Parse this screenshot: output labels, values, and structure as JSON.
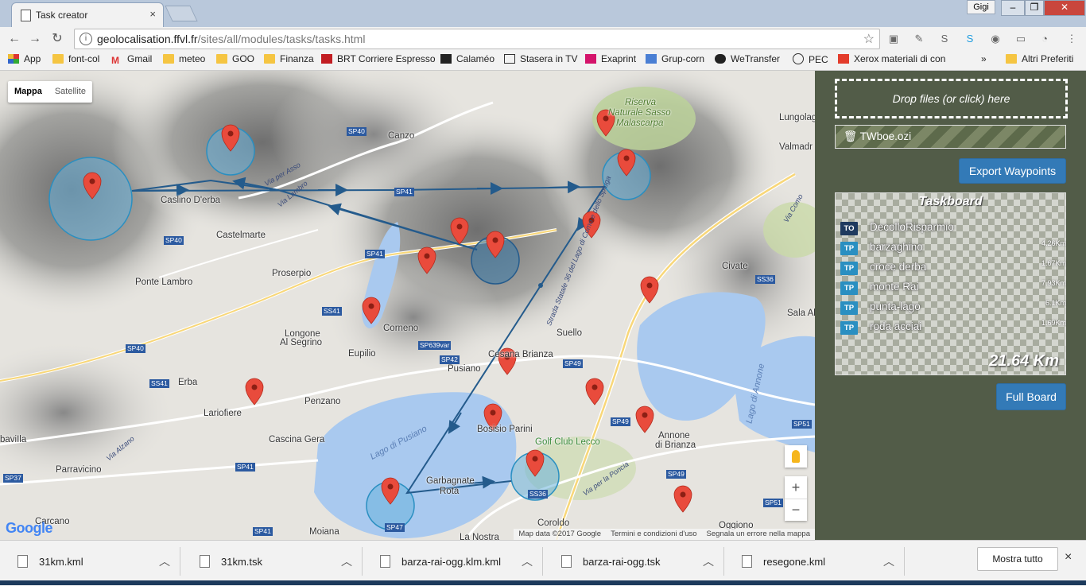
{
  "browser": {
    "tab_title": "Task creator",
    "tab_close": "×",
    "profile": "Gigi",
    "url_host": "geolocalisation.ffvl.fr",
    "url_path": "/sites/all/modules/tasks/tasks.html"
  },
  "bookmarks": [
    {
      "label": "App",
      "icon": "apps-grid-icon"
    },
    {
      "label": "font-col",
      "icon": "folder-icon"
    },
    {
      "label": "Gmail",
      "icon": "gmail-icon"
    },
    {
      "label": "meteo",
      "icon": "folder-icon"
    },
    {
      "label": "GOO",
      "icon": "folder-icon"
    },
    {
      "label": "Finanza",
      "icon": "folder-icon"
    },
    {
      "label": "BRT Corriere Espresso",
      "icon": "brt-icon"
    },
    {
      "label": "Calaméo",
      "icon": "calameo-icon"
    },
    {
      "label": "Stasera in TV",
      "icon": "tv-icon"
    },
    {
      "label": "Exaprint",
      "icon": "exaprint-icon"
    },
    {
      "label": "Grup-corn",
      "icon": "group-icon"
    },
    {
      "label": "WeTransfer",
      "icon": "wetransfer-icon"
    },
    {
      "label": "PEC",
      "icon": "pec-icon"
    },
    {
      "label": "Xerox materiali di con",
      "icon": "xerox-icon"
    },
    {
      "label": "»",
      "icon": ""
    },
    {
      "label": "Altri Preferiti",
      "icon": "folder-icon"
    }
  ],
  "map": {
    "type_control": {
      "map_label": "Mappa",
      "satellite_label": "Satellite"
    },
    "places": [
      {
        "name": "Canzo"
      },
      {
        "name": "Caslino D'erba"
      },
      {
        "name": "Castelmarte"
      },
      {
        "name": "Ponte Lambro"
      },
      {
        "name": "Proserpio"
      },
      {
        "name": "Longone"
      },
      {
        "name": "Al Segrino"
      },
      {
        "name": "Eupilio"
      },
      {
        "name": "Corneno"
      },
      {
        "name": "Cesana Brianza"
      },
      {
        "name": "Suello"
      },
      {
        "name": "Pusiano"
      },
      {
        "name": "Erba"
      },
      {
        "name": "Lariofiere"
      },
      {
        "name": "Penzano"
      },
      {
        "name": "Cascina Gera"
      },
      {
        "name": "Parravicino"
      },
      {
        "name": "Bosisio Parini"
      },
      {
        "name": "Garbagnate"
      },
      {
        "name": "Rota"
      },
      {
        "name": "Annone"
      },
      {
        "name": "di Brianza"
      },
      {
        "name": "Civate"
      },
      {
        "name": "Lungolago"
      },
      {
        "name": "Valmadr"
      },
      {
        "name": "Sala Al"
      },
      {
        "name": "Carcano"
      },
      {
        "name": "Moiana"
      },
      {
        "name": "La Nostra"
      },
      {
        "name": "Coroldo"
      },
      {
        "name": "Oggiono"
      },
      {
        "name": "baviIla"
      }
    ],
    "reserve_label": [
      "Riserva",
      "Naturale Sasso",
      "Malascarpa"
    ],
    "golf_label": "Golf Club Lecco",
    "lakes": [
      "Lago di Pusiano",
      "Lago di Annone"
    ],
    "roads": [
      "SP40",
      "SP41",
      "SS41",
      "SS36",
      "SP639var",
      "SP42",
      "SP49",
      "SS36",
      "SP47",
      "SP51",
      "SP37",
      "SS41",
      "SP41"
    ],
    "small_roads": [
      "Via per Asso",
      "Via Lambro",
      "Via Como",
      "Strada Statale 36 del Lago di Como e dello Spluga",
      "Via per la Poncia",
      "Via Alzano"
    ],
    "zoom_in": "+",
    "zoom_out": "−",
    "attribution": {
      "map_data": "Map data ©2017 Google",
      "terms": "Termini e condizioni d'uso",
      "report": "Segnala un errore nella mappa"
    },
    "google_logo": "Google"
  },
  "panel": {
    "dropzone_text": "Drop files (or click) here",
    "file_name": "TWboe.ozi",
    "export_button": "Export Waypoints",
    "taskboard_title": "Taskboard",
    "waypoints": [
      {
        "badge": "TO",
        "name": "DecolloRisparmio",
        "distance": ""
      },
      {
        "badge": "TP",
        "name": "barzaghino",
        "distance": "4.26Km"
      },
      {
        "badge": "TP",
        "name": "croce derba",
        "distance": "1.67Km"
      },
      {
        "badge": "TP",
        "name": "monte Rai",
        "distance": "7.93Km"
      },
      {
        "badge": "TP",
        "name": "punta-lago",
        "distance": "6.1Km"
      },
      {
        "badge": "TP",
        "name": "roda acciai",
        "distance": "1.69Km"
      }
    ],
    "total_distance": "21.64 Km",
    "full_board_button": "Full Board",
    "colors": {
      "to_badge": "#1f3a5f",
      "tp_badge": "#2a8fc1",
      "button": "#337ab7",
      "panel_bg": "#525c48"
    }
  },
  "downloads": {
    "items": [
      {
        "name": "31km.kml"
      },
      {
        "name": "31km.tsk"
      },
      {
        "name": "barza-rai-ogg.klm.kml"
      },
      {
        "name": "barza-rai-ogg.tsk"
      },
      {
        "name": "resegone.kml"
      }
    ],
    "show_all": "Mostra tutto",
    "close": "×"
  }
}
